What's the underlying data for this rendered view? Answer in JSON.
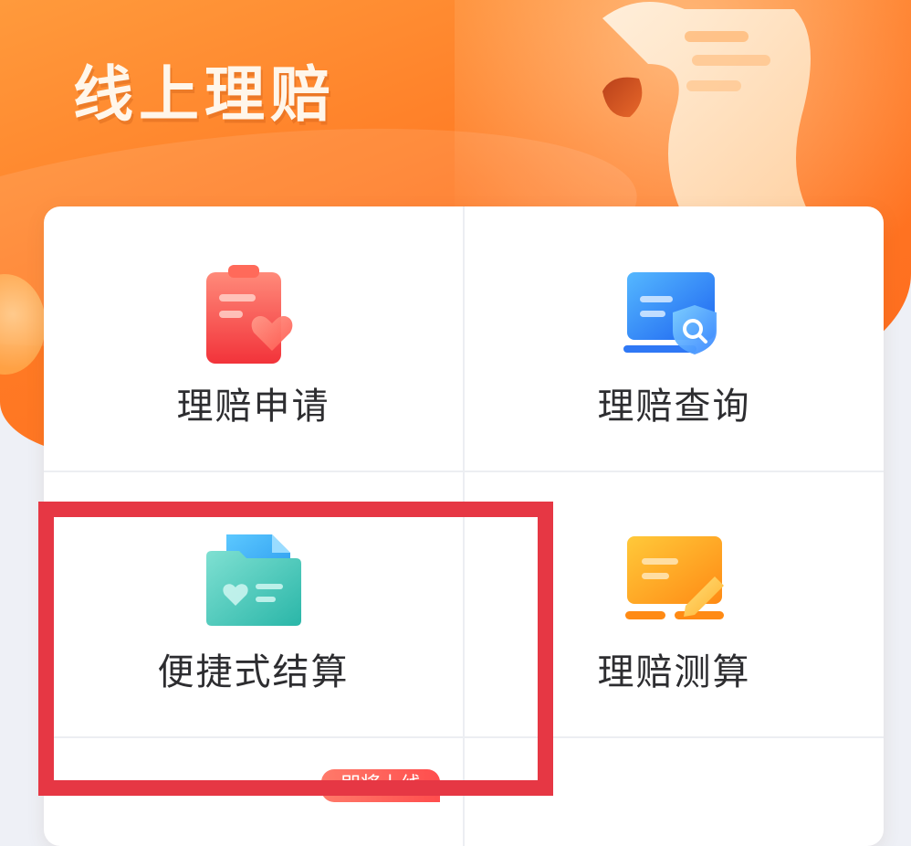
{
  "header": {
    "title": "线上理赔"
  },
  "menu": {
    "items": [
      {
        "label": "理赔申请",
        "icon": "clipboard-heart-icon"
      },
      {
        "label": "理赔查询",
        "icon": "document-search-shield-icon"
      },
      {
        "label": "便捷式结算",
        "icon": "folder-heart-icon"
      },
      {
        "label": "理赔测算",
        "icon": "document-pencil-icon"
      }
    ]
  },
  "badge": {
    "text": "即将上线"
  },
  "colors": {
    "header_orange": "#ff7a24",
    "highlight_red": "#e63744",
    "label_text": "#2d2d30"
  }
}
